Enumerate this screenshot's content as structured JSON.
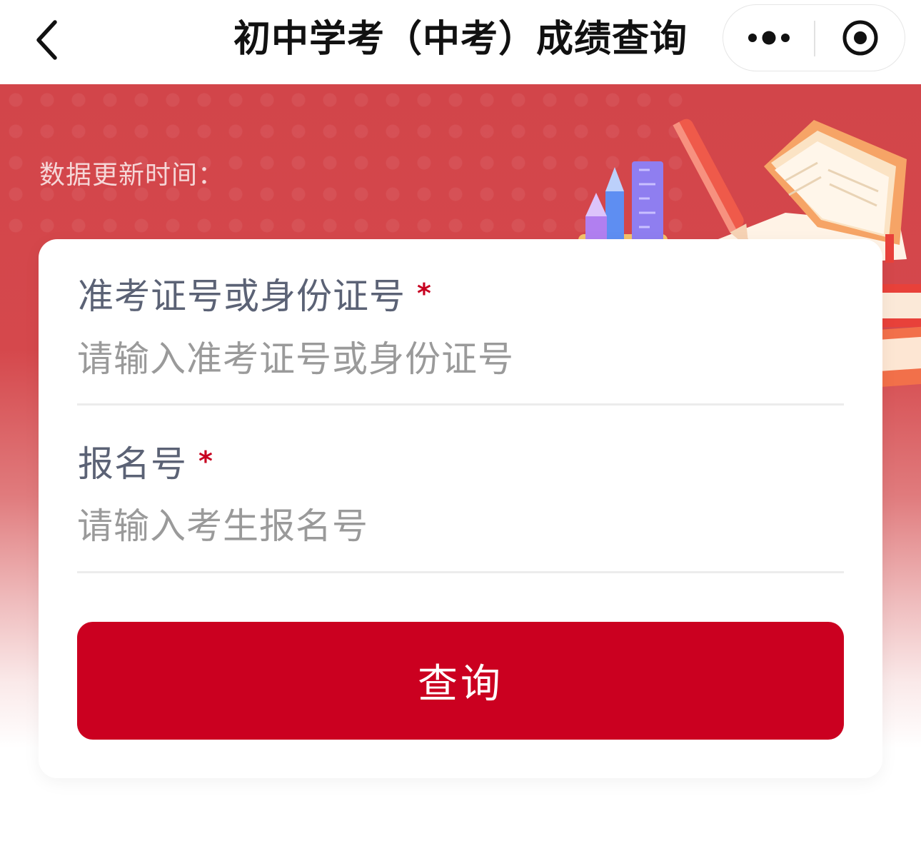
{
  "navbar": {
    "title": "初中学考（中考）成绩查询",
    "back_icon": "chevron-left-icon",
    "more_icon": "more-dots-icon",
    "close_icon": "target-circle-icon"
  },
  "hero": {
    "update_time_label": "数据更新时间："
  },
  "form": {
    "id_field": {
      "label": "准考证号或身份证号",
      "required_mark": "*",
      "value": "",
      "placeholder": "请输入准考证号或身份证号"
    },
    "reg_field": {
      "label": "报名号",
      "required_mark": "*",
      "value": "",
      "placeholder": "请输入考生报名号"
    },
    "submit_label": "查询"
  },
  "colors": {
    "primary": "#cb0020",
    "hero_red": "#d2454a",
    "label_text": "#5b6275",
    "placeholder": "#9a9a9a"
  }
}
